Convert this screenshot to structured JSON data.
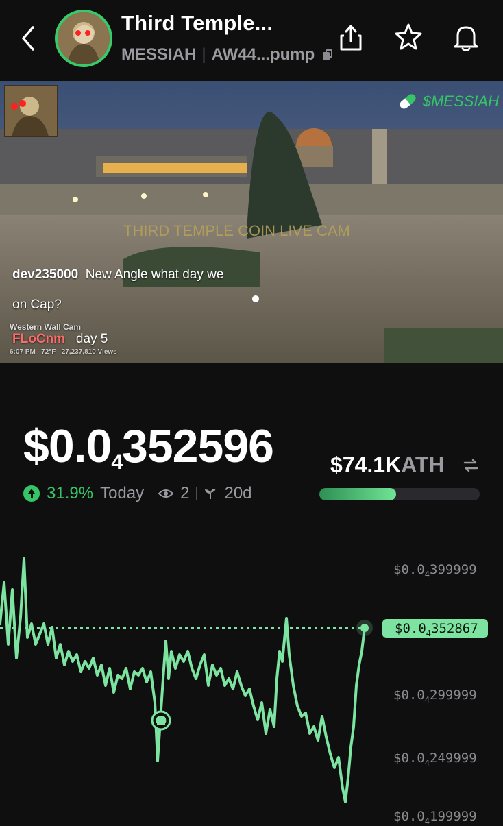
{
  "header": {
    "title": "Third Temple...",
    "ticker": "MESSIAH",
    "address": "AW44...pump"
  },
  "stream": {
    "overlay_ticker": "$MESSIAH",
    "cam_title": "THIRD TEMPLE COIN LIVE CAM",
    "chat": [
      {
        "user": "dev235000",
        "message": "New Angle what day we",
        "message_cont": "on Cap?"
      },
      {
        "user": "FLoCnm",
        "message": "day 5"
      }
    ],
    "cam_name": "Western Wall Cam",
    "cam_time": "6:07 PM",
    "cam_temp": "72°F",
    "cam_views": "27,237,810 Views"
  },
  "price": {
    "prefix": "$0.0",
    "zeros": "4",
    "digits": "352596",
    "change": "31.9%",
    "change_period": "Today",
    "watchers": "2",
    "age": "20d"
  },
  "market_cap": {
    "value": "$74.1K",
    "label": "ATH",
    "ath_progress": 0.48
  },
  "chart": {
    "y_labels": [
      {
        "prefix": "$0.0",
        "zeros": "4",
        "digits": "399999"
      },
      {
        "prefix": "$0.0",
        "zeros": "4",
        "digits": "299999"
      },
      {
        "prefix": "$0.0",
        "zeros": "4",
        "digits": "249999"
      },
      {
        "prefix": "$0.0",
        "zeros": "4",
        "digits": "199999"
      }
    ],
    "current": {
      "prefix": "$0.0",
      "zeros": "4",
      "digits": "352867"
    }
  },
  "colors": {
    "accent_green": "#35c566",
    "line_green": "#7de3a0",
    "background": "#0f0f10",
    "muted": "#9a9a9f"
  }
}
